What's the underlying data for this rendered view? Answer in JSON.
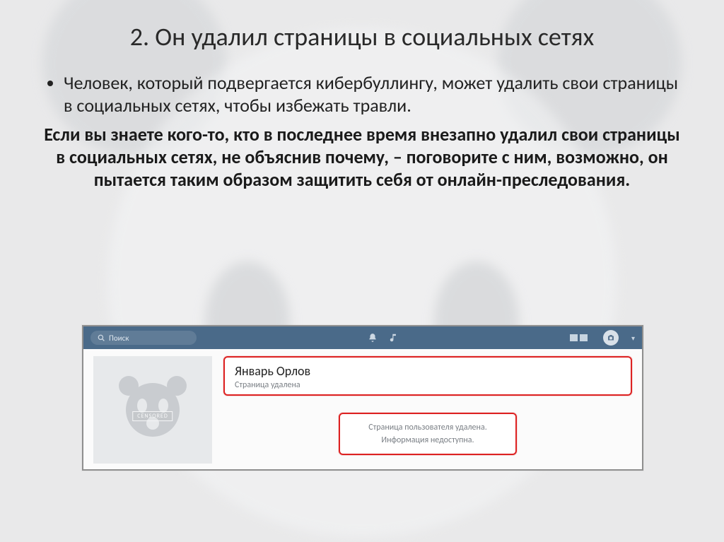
{
  "slide": {
    "title": "2. Он удалил страницы в социальных сетях",
    "paragraph1": "Человек, который подвергается кибербуллингу, может удалить свои страницы в социальных сетях, чтобы избежать травли.",
    "paragraph2": "Если вы знаете кого-то, кто в последнее время внезапно удалил свои страницы в социальных сетях, не объяснив почему, – поговорите с ним, возможно, он пытается таким образом защитить себя от онлайн-преследования."
  },
  "screenshot": {
    "search_placeholder": "Поиск",
    "censored_label": "CENSORED",
    "profile_name": "Январь Орлов",
    "profile_status": "Страница удалена",
    "info_line1": "Страница пользователя удалена.",
    "info_line2": "Информация недоступна."
  }
}
